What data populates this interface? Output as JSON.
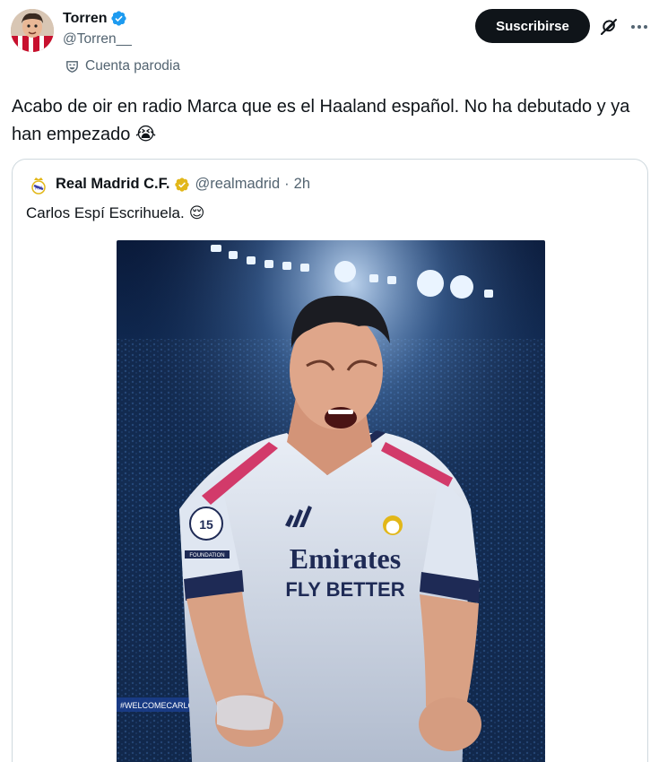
{
  "author": {
    "display_name": "Torren",
    "handle": "@Torren__",
    "parody_label": "Cuenta parodia",
    "verified_color": "#1d9bf0"
  },
  "actions": {
    "subscribe_label": "Suscribirse",
    "grok_icon": "grok-icon",
    "more_icon": "more-options-icon"
  },
  "tweet": {
    "text": "Acabo de oir en radio Marca que es el Haaland español. No ha debutado y ya han empezado",
    "emoji": "😭"
  },
  "quote": {
    "display_name": "Real Madrid C.F.",
    "handle": "@realmadrid",
    "separator": "·",
    "time": "2h",
    "text": "Carlos Espí Escrihuela.",
    "emoji": "😌",
    "badge_color": "#e2b719",
    "image": {
      "hashtag_banner": "#WELCOMECARLOSESPI",
      "sponsor_line1": "Emirates",
      "sponsor_line2": "FLY BETTER",
      "sleeve_badge": "15",
      "sleeve_label": "FOUNDATION"
    }
  },
  "colors": {
    "text_primary": "#0f1419",
    "text_secondary": "#536471",
    "border": "#cfd9de",
    "button_bg": "#0f1419"
  }
}
